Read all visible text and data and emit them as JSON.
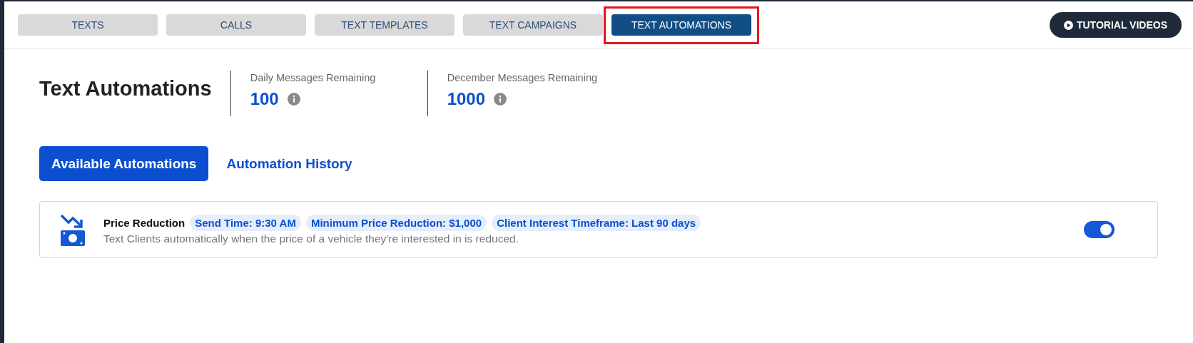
{
  "nav_tabs": [
    {
      "label": "TEXTS",
      "selected": false,
      "highlighted": false
    },
    {
      "label": "CALLS",
      "selected": false,
      "highlighted": false
    },
    {
      "label": "TEXT TEMPLATES",
      "selected": false,
      "highlighted": false
    },
    {
      "label": "TEXT CAMPAIGNS",
      "selected": false,
      "highlighted": false
    },
    {
      "label": "TEXT AUTOMATIONS",
      "selected": true,
      "highlighted": true
    }
  ],
  "tutorial_button": {
    "label": "TUTORIAL VIDEOS"
  },
  "page_title": "Text Automations",
  "stats": [
    {
      "label": "Daily Messages Remaining",
      "value": "100"
    },
    {
      "label": "December Messages Remaining",
      "value": "1000"
    }
  ],
  "view_tabs": [
    {
      "label": "Available Automations",
      "selected": true
    },
    {
      "label": "Automation History",
      "selected": false
    }
  ],
  "automations": [
    {
      "name": "Price Reduction",
      "tags": [
        "Send Time: 9:30 AM",
        "Minimum Price Reduction: $1,000",
        "Client Interest Timeframe: Last 90 days"
      ],
      "description": "Text Clients automatically when the price of a vehicle they're interested in is reduced.",
      "on": true
    }
  ]
}
